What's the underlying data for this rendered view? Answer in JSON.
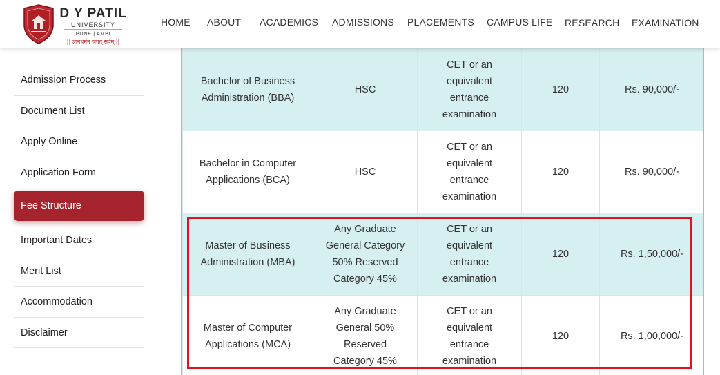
{
  "logo": {
    "name": "D Y PATIL",
    "university": "UNIVERSITY",
    "city": "PUNE | AMBI",
    "motto": "|| ज्ञानधर्मेन जगत् सर्वम् ||"
  },
  "nav": {
    "items": [
      "HOME",
      "ABOUT",
      "ACADEMICS",
      "ADMISSIONS",
      "PLACEMENTS",
      "CAMPUS LIFE",
      "RESEARCH",
      "EXAMINATION"
    ]
  },
  "sidebar": {
    "items": [
      {
        "label": "Admission Process",
        "active": false
      },
      {
        "label": "Document List",
        "active": false
      },
      {
        "label": "Apply Online",
        "active": false
      },
      {
        "label": "Application Form",
        "active": false
      },
      {
        "label": "Fee Structure",
        "active": true
      },
      {
        "label": "Important Dates",
        "active": false
      },
      {
        "label": "Merit List",
        "active": false
      },
      {
        "label": "Accommodation",
        "active": false
      },
      {
        "label": "Disclaimer",
        "active": false
      }
    ]
  },
  "fee_table": {
    "rows": [
      {
        "course": "Bachelor of Business Administration (BBA)",
        "eligibility": "HSC",
        "exam": "CET or an equivalent entrance examination",
        "intake": "120",
        "fee": "Rs. 90,000/-"
      },
      {
        "course": "Bachelor in Computer Applications (BCA)",
        "eligibility": "HSC",
        "exam": "CET or an equivalent entrance examination",
        "intake": "120",
        "fee": "Rs. 90,000/-"
      },
      {
        "course": "Master of Business Administration (MBA)",
        "eligibility": "Any Graduate General Category 50% Reserved Category 45%",
        "exam": "CET or an equivalent entrance examination",
        "intake": "120",
        "fee": "Rs. 1,50,000/-"
      },
      {
        "course": "Master of Computer Applications (MCA)",
        "eligibility": "Any Graduate General 50% Reserved Category 45%",
        "exam": "CET or an equivalent entrance examination",
        "intake": "120",
        "fee": "Rs. 1,00,000/-"
      }
    ]
  },
  "colors": {
    "accent": "#a4232d",
    "row_shade": "#d6eff1",
    "table_border": "#8ec7cd",
    "highlight": "#e0141e"
  }
}
